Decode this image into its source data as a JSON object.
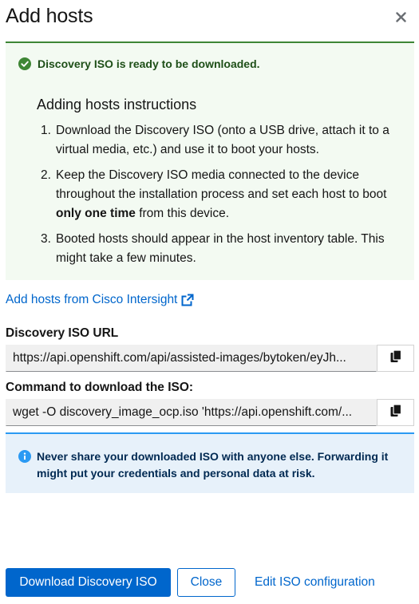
{
  "modal": {
    "title": "Add hosts",
    "close_icon": "close-icon"
  },
  "success_alert": {
    "icon": "check-circle-icon",
    "message": "Discovery ISO is ready to be downloaded.",
    "color": "#3e8635"
  },
  "instructions": {
    "title": "Adding hosts instructions",
    "items": [
      {
        "num": "1.",
        "text": "Download the Discovery ISO (onto a USB drive, attach it to a virtual media, etc.) and use it to boot your hosts."
      },
      {
        "num": "2.",
        "text_before": "Keep the Discovery ISO media connected to the device throughout the installation process and set each host to boot ",
        "text_bold": "only one time",
        "text_after": " from this device."
      },
      {
        "num": "3.",
        "text": "Booted hosts should appear in the host inventory table. This might take a few minutes."
      }
    ]
  },
  "intersight_link": {
    "label": "Add hosts from Cisco Intersight",
    "icon": "external-link-icon"
  },
  "iso_url": {
    "label": "Discovery ISO URL",
    "value": "https://api.openshift.com/api/assisted-images/bytoken/eyJh...",
    "copy_icon": "copy-icon"
  },
  "download_command": {
    "label": "Command to download the ISO:",
    "value": "wget -O discovery_image_ocp.iso 'https://api.openshift.com/...",
    "copy_icon": "copy-icon"
  },
  "info_alert": {
    "icon": "info-circle-icon",
    "message": "Never share your downloaded ISO with anyone else. Forwarding it might put your credentials and personal data at risk.",
    "color": "#2b9af3"
  },
  "footer": {
    "primary_label": "Download Discovery ISO",
    "secondary_label": "Close",
    "link_label": "Edit ISO configuration"
  },
  "colors": {
    "accent": "#0066cc",
    "success": "#3e8635",
    "info": "#2b9af3"
  }
}
